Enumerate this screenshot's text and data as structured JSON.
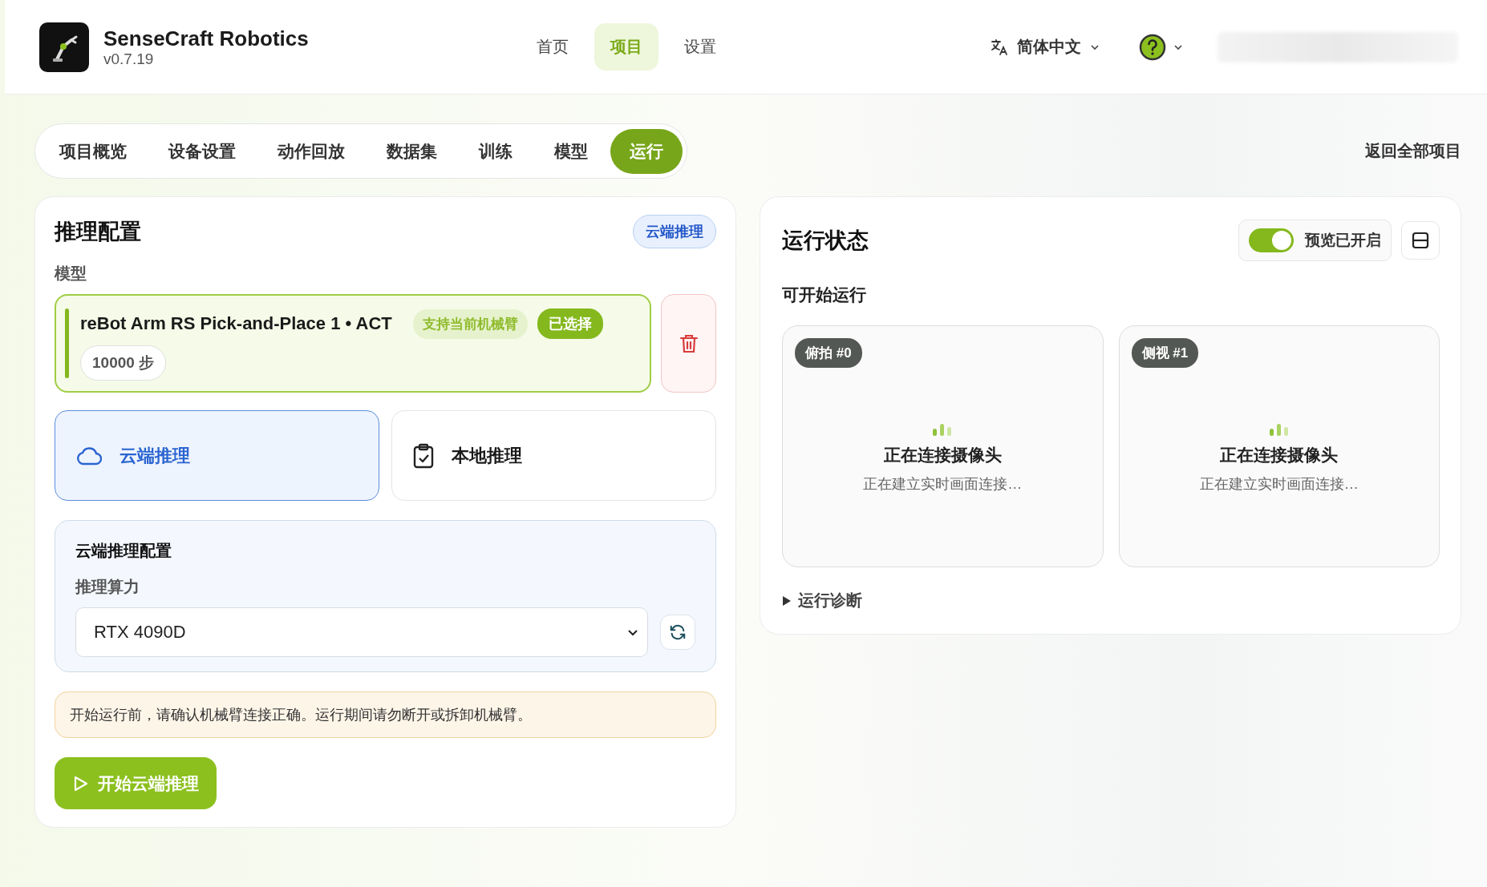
{
  "header": {
    "app_name": "SenseCraft Robotics",
    "version": "v0.7.19",
    "nav": [
      {
        "label": "首页",
        "selected": false
      },
      {
        "label": "项目",
        "selected": true
      },
      {
        "label": "设置",
        "selected": false
      }
    ],
    "language": "简体中文"
  },
  "tabs": [
    {
      "label": "项目概览",
      "selected": false
    },
    {
      "label": "设备设置",
      "selected": false
    },
    {
      "label": "动作回放",
      "selected": false
    },
    {
      "label": "数据集",
      "selected": false
    },
    {
      "label": "训练",
      "selected": false
    },
    {
      "label": "模型",
      "selected": false
    },
    {
      "label": "运行",
      "selected": true
    }
  ],
  "back_link": "返回全部项目",
  "config": {
    "title": "推理配置",
    "mode_badge": "云端推理",
    "model_label": "模型",
    "model": {
      "name": "reBot Arm RS Pick-and-Place 1",
      "separator": "•",
      "policy": "ACT",
      "support_badge": "支持当前机械臂",
      "selected_badge": "已选择",
      "selected": true,
      "steps": "10000 步"
    },
    "modes": [
      {
        "kind": "cloud",
        "label": "云端推理",
        "selected": true
      },
      {
        "kind": "local",
        "label": "本地推理",
        "selected": false
      }
    ],
    "cloud_config": {
      "title": "云端推理配置",
      "compute_label": "推理算力",
      "compute_value": "RTX 4090D"
    },
    "warning": "开始运行前，请确认机械臂连接正确。运行期间请勿断开或拆卸机械臂。",
    "start_button": "开始云端推理"
  },
  "status": {
    "title": "运行状态",
    "preview": {
      "label": "预览已开启",
      "on": true
    },
    "ready_text": "可开始运行",
    "cameras": [
      {
        "tag": "俯拍 #0",
        "title": "正在连接摄像头",
        "subtitle": "正在建立实时画面连接…"
      },
      {
        "tag": "侧视 #1",
        "title": "正在连接摄像头",
        "subtitle": "正在建立实时画面连接…"
      }
    ],
    "diagnostics": {
      "label": "运行诊断",
      "expanded": false
    }
  }
}
